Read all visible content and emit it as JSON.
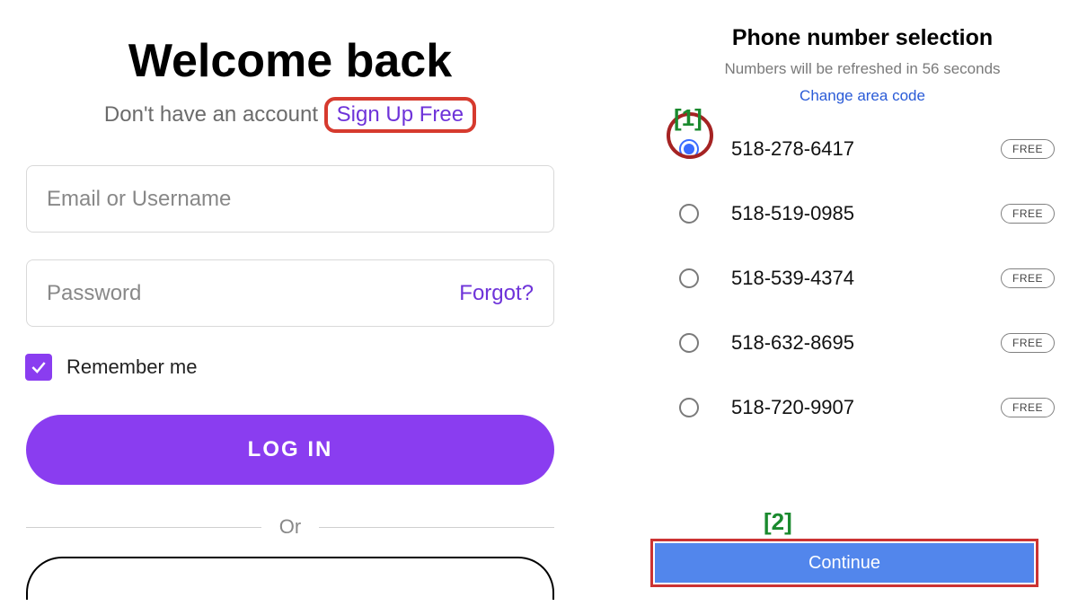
{
  "login": {
    "title": "Welcome back",
    "subtitle_prefix": "Don't have an account ",
    "signup_label": "Sign Up Free",
    "email_placeholder": "Email or Username",
    "password_placeholder": "Password",
    "forgot_label": "Forgot?",
    "remember_label": "Remember me",
    "remember_checked": true,
    "login_label": "LOG IN",
    "or_label": "Or"
  },
  "selection": {
    "title": "Phone number selection",
    "refresh_line": "Numbers will be refreshed in 56 seconds",
    "change_label": "Change area code",
    "free_badge": "FREE",
    "continue_label": "Continue",
    "selected_index": 0,
    "numbers": [
      "518-278-6417",
      "518-519-0985",
      "518-539-4374",
      "518-632-8695",
      "518-720-9907"
    ]
  },
  "annotations": {
    "step1": "[1]",
    "step2": "[2]"
  }
}
